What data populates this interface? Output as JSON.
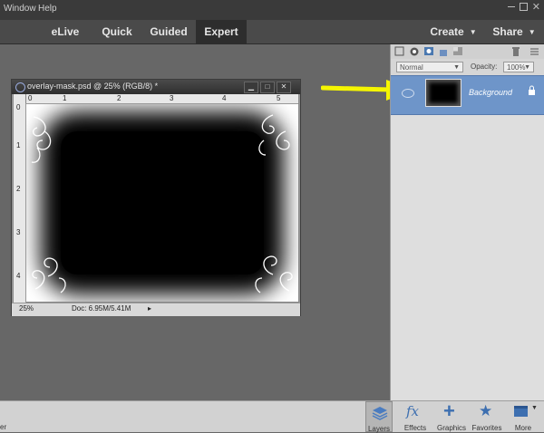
{
  "menu": {
    "items": [
      "Window",
      "Help"
    ],
    "truncated_left": "er"
  },
  "modes": [
    {
      "label": "eLive",
      "active": false
    },
    {
      "label": "Quick",
      "active": false
    },
    {
      "label": "Guided",
      "active": false
    },
    {
      "label": "Expert",
      "active": true
    }
  ],
  "topright": {
    "create": "Create",
    "share": "Share"
  },
  "document": {
    "title": "overlay-mask.psd @ 25% (RGB/8) *",
    "ruler_h": [
      "0",
      "1",
      "2",
      "3",
      "4",
      "5"
    ],
    "ruler_v": [
      "0",
      "1",
      "2",
      "3",
      "4"
    ],
    "zoom": "25%",
    "doc_info": "Doc: 6.95M/5.41M"
  },
  "layers_panel": {
    "blend_mode": "Normal",
    "opacity_label": "Opacity:",
    "opacity_value": "100%",
    "layer_name": "Background"
  },
  "bottom_buttons": [
    {
      "label": "Layers",
      "icon": "layers-icon",
      "active": true
    },
    {
      "label": "Effects",
      "icon": "fx-icon",
      "active": false
    },
    {
      "label": "Graphics",
      "icon": "plus-icon",
      "active": false
    },
    {
      "label": "Favorites",
      "icon": "star-icon",
      "active": false
    },
    {
      "label": "More",
      "icon": "more-icon",
      "active": false
    }
  ],
  "colors": {
    "accent_arrow": "#f5f500",
    "layer_selected": "#6e95c9",
    "active_tab": "#2d2d2d"
  }
}
